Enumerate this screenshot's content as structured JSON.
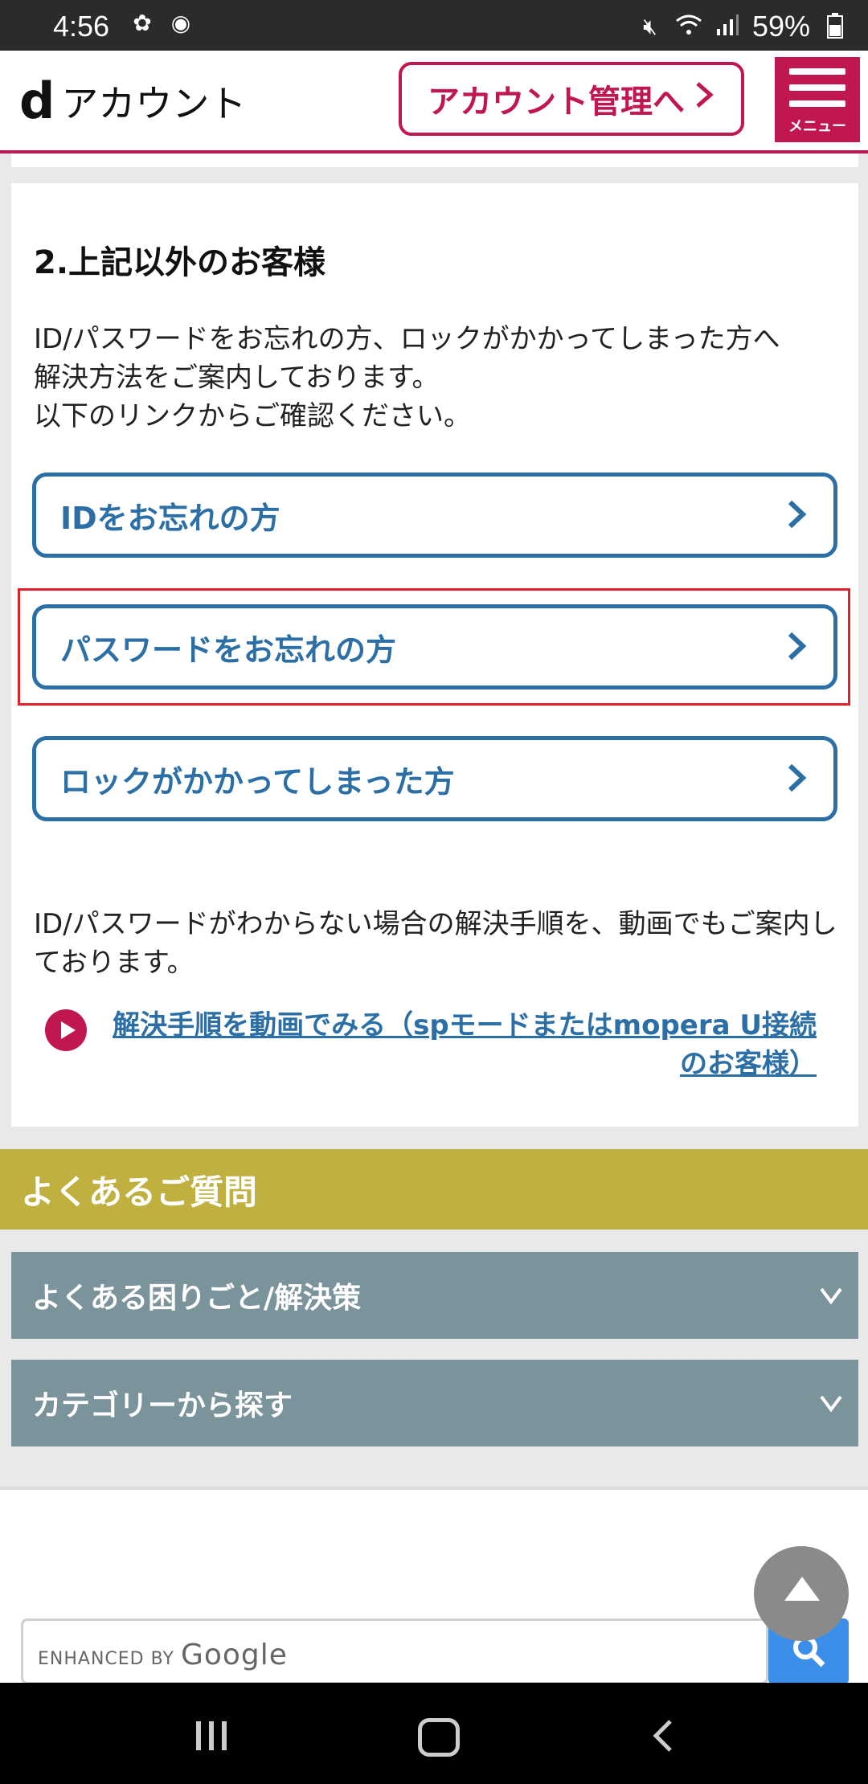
{
  "status_bar": {
    "time": "4:56",
    "battery": "59%",
    "icons_left": [
      "pinwheel-icon",
      "line-app-icon"
    ],
    "icons_right": [
      "mute-icon",
      "wifi-icon",
      "signal-icon",
      "battery-icon"
    ]
  },
  "header": {
    "logo_mark": "d",
    "logo_text": "アカウント",
    "account_button": "アカウント管理へ",
    "menu_label": "メニュー",
    "accent_color": "#c0174e"
  },
  "section": {
    "title": "2.上記以外のお客様",
    "desc_lines": [
      "ID/パスワードをお忘れの方、ロックがかかってしまった方へ",
      "解決方法をご案内しております。",
      "以下のリンクからご確認ください。"
    ],
    "links": [
      {
        "label": "IDをお忘れの方"
      },
      {
        "label": "パスワードをお忘れの方"
      },
      {
        "label": "ロックがかかってしまった方"
      }
    ],
    "desc2": "ID/パスワードがわからない場合の解決手順を、動画でもご案内しております。",
    "video_link_line1": "解決手順を動画でみる（spモードまたはmopera U接続",
    "video_link_line2": "のお客様）",
    "link_color": "#2b6fa6"
  },
  "faq": {
    "title": "よくあるご質問",
    "items": [
      {
        "label": "よくある困りごと/解決策"
      },
      {
        "label": "カテゴリーから探す"
      }
    ]
  },
  "search": {
    "enhanced_by": "ENHANCED BY",
    "google": "Google"
  }
}
